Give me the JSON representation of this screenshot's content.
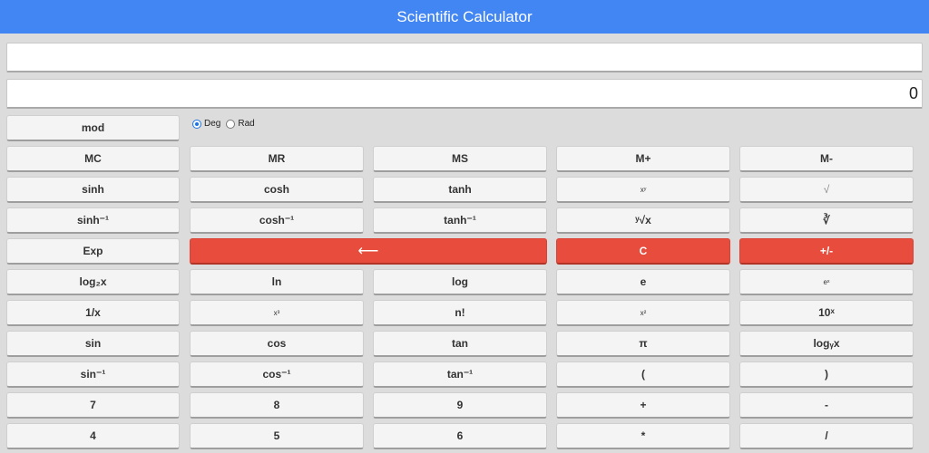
{
  "header": {
    "title": "Scientific Calculator"
  },
  "display": {
    "expression": "",
    "result": "0"
  },
  "angle": {
    "deg": "Deg",
    "rad": "Rad",
    "selected": "Deg"
  },
  "buttons": {
    "mod": "mod",
    "mc": "MC",
    "mr": "MR",
    "ms": "MS",
    "mplus": "M+",
    "mminus": "M-",
    "sinh": "sinh",
    "cosh": "cosh",
    "tanh": "tanh",
    "xy": "xʸ",
    "sqrt": "√",
    "asinh": "sinh⁻¹",
    "acosh": "cosh⁻¹",
    "atanh": "tanh⁻¹",
    "yroot": "ʸ√x",
    "cbrt": "∛",
    "exp": "Exp",
    "back": "⟵",
    "clear": "C",
    "negate": "+/-",
    "log2": "log₂x",
    "ln": "ln",
    "log": "log",
    "e": "e",
    "ex": "eˣ",
    "recip": "1/x",
    "x3": "x³",
    "fact": "n!",
    "x2": "x²",
    "tenx": "10ˣ",
    "sin": "sin",
    "cos": "cos",
    "tan": "tan",
    "pi": "π",
    "logy": "logᵧx",
    "asin": "sin⁻¹",
    "acos": "cos⁻¹",
    "atan": "tan⁻¹",
    "lparen": "(",
    "rparen": ")",
    "n7": "7",
    "n8": "8",
    "n9": "9",
    "plus": "+",
    "minus": "-",
    "n4": "4",
    "n5": "5",
    "n6": "6",
    "times": "*",
    "divide": "/"
  }
}
